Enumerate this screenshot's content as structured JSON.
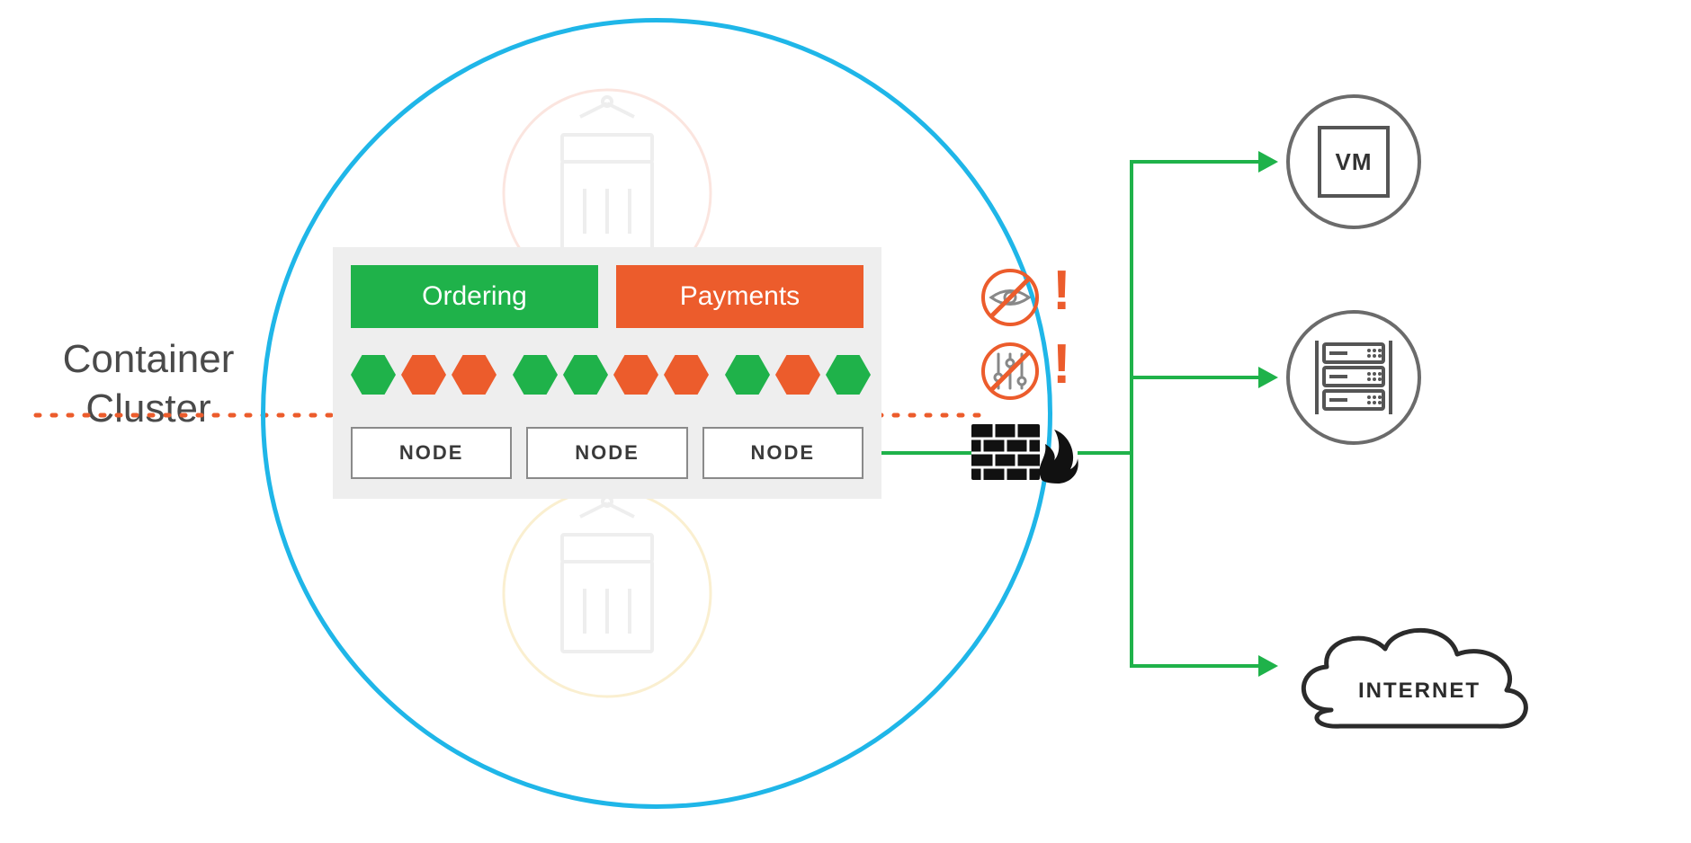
{
  "title_line1": "Container",
  "title_line2": "Cluster",
  "services": {
    "ordering": "Ordering",
    "payments": "Payments"
  },
  "nodes": [
    "NODE",
    "NODE",
    "NODE"
  ],
  "hexagons": [
    {
      "color": "#1fb24a"
    },
    {
      "color": "#ec5c2c"
    },
    {
      "color": "#ec5c2c"
    },
    {
      "color": "#1fb24a"
    },
    {
      "color": "#1fb24a"
    },
    {
      "color": "#ec5c2c"
    },
    {
      "color": "#ec5c2c"
    },
    {
      "color": "#1fb24a"
    },
    {
      "color": "#ec5c2c"
    },
    {
      "color": "#1fb24a"
    }
  ],
  "destinations": {
    "vm": "VM",
    "internet": "INTERNET"
  },
  "alerts": {
    "no_visibility": "no-visibility-icon",
    "no_control": "no-control-icon",
    "bang1": "!",
    "bang2": "!"
  },
  "firewall_label": "firewall-icon",
  "colors": {
    "green": "#1fb24a",
    "orange": "#ec5c2c",
    "blue": "#1fb6e8",
    "grey": "#6b6b6b"
  }
}
